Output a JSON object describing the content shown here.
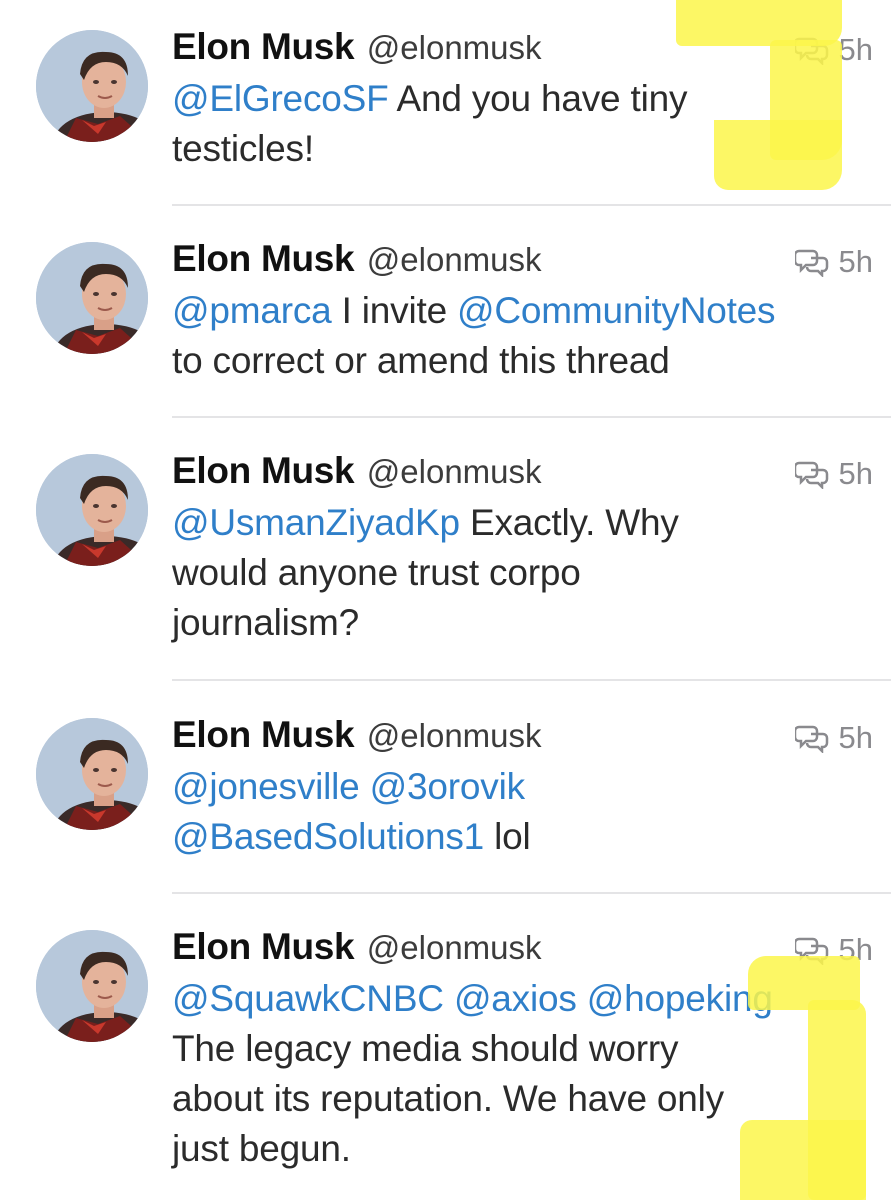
{
  "tweets": [
    {
      "name": "Elon Musk",
      "handle": "@elonmusk",
      "time": "5h",
      "line1_mentions": [
        "@ElGrecoSF"
      ],
      "line1_text": " And you have tiny",
      "line2": "testicles!"
    },
    {
      "name": "Elon Musk",
      "handle": "@elonmusk",
      "time": "5h",
      "m1": "@pmarca",
      "mid": " I invite ",
      "m2": "@CommunityNotes",
      "line2": "to correct or amend this thread"
    },
    {
      "name": "Elon Musk",
      "handle": "@elonmusk",
      "time": "5h",
      "m1": "@UsmanZiyadKp",
      "line1_text": " Exactly. Why",
      "line2": "would anyone trust corpo",
      "line3": "journalism?"
    },
    {
      "name": "Elon Musk",
      "handle": "@elonmusk",
      "time": "5h",
      "m1": "@jonesville",
      "m2": "@3orovik",
      "m3": "@BasedSolutions1",
      "tail": " lol"
    },
    {
      "name": "Elon Musk",
      "handle": "@elonmusk",
      "time": "5h",
      "m1": "@SquawkCNBC",
      "m2": "@axios",
      "m3": "@hopeking",
      "line2": "The legacy media should worry",
      "line3": "about its reputation. We have only",
      "line4": "just begun."
    }
  ],
  "icons": {
    "reply": "speech-bubbles-icon"
  },
  "colors": {
    "mention": "#2f7fc9",
    "highlight": "#fbf64a",
    "meta": "#8a8a8e"
  }
}
